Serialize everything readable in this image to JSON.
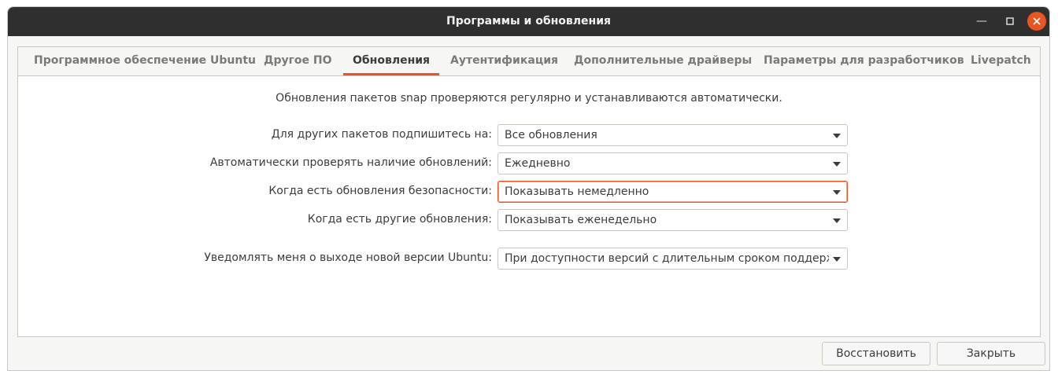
{
  "window": {
    "title": "Программы и обновления"
  },
  "tabs": [
    {
      "label": "Программное обеспечение Ubuntu"
    },
    {
      "label": "Другое ПО"
    },
    {
      "label": "Обновления"
    },
    {
      "label": "Аутентификация"
    },
    {
      "label": "Дополнительные драйверы"
    },
    {
      "label": "Параметры для разработчиков"
    },
    {
      "label": "Livepatch"
    }
  ],
  "active_tab": "Обновления",
  "updates": {
    "snap_info": "Обновления пакетов snap проверяются регулярно и устанавливаются автоматически.",
    "rows": [
      {
        "label": "Для других пакетов подпишитесь на:",
        "value": "Все обновления"
      },
      {
        "label": "Автоматически проверять наличие обновлений:",
        "value": "Ежедневно"
      },
      {
        "label": "Когда есть обновления безопасности:",
        "value": "Показывать немедленно"
      },
      {
        "label": "Когда есть другие обновления:",
        "value": "Показывать еженедельно"
      },
      {
        "label": "Уведомлять меня о выходе новой версии Ubuntu:",
        "value": "При доступности версий с длительным сроком поддержки"
      }
    ]
  },
  "buttons": {
    "revert": "Восстановить",
    "close": "Закрыть"
  },
  "colors": {
    "accent": "#e95420",
    "titlebar": "#2f2f2f"
  }
}
